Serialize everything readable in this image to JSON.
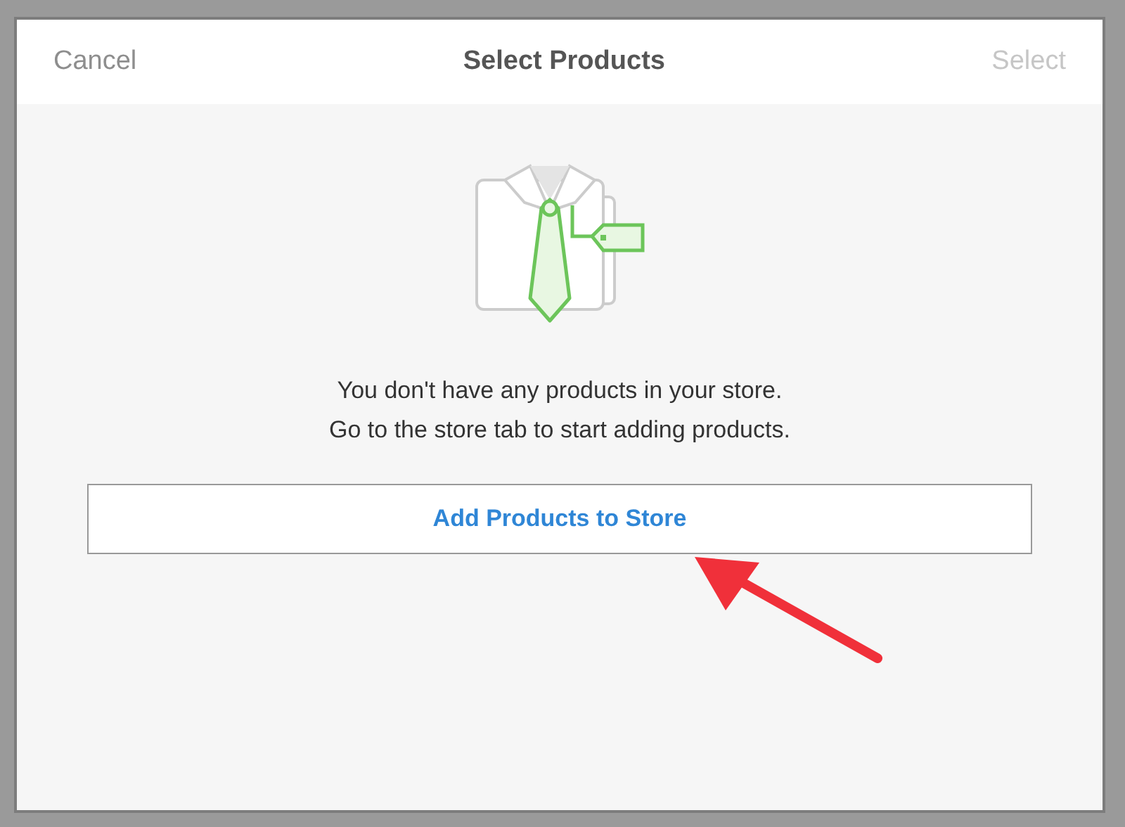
{
  "dialog": {
    "title": "Select Products",
    "cancel": "Cancel",
    "confirm": {
      "label": "Select",
      "disabled": true
    }
  },
  "empty_state": {
    "lines": [
      "You don't have any products in your store.",
      "Go to the store tab to start adding products."
    ],
    "button": "Add Products to Store"
  },
  "annotation": {
    "kind": "arrow"
  }
}
